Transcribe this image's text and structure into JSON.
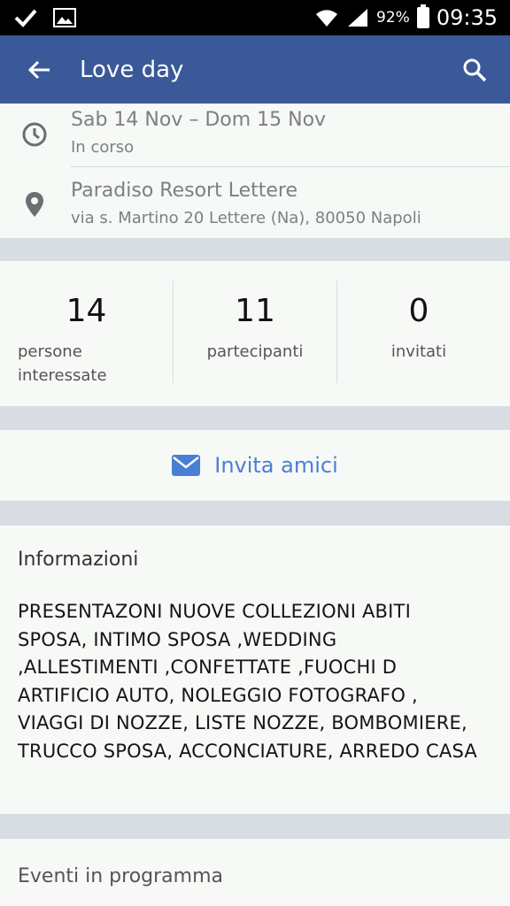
{
  "status_bar": {
    "battery": "92%",
    "time": "09:35"
  },
  "app_bar": {
    "title": "Love day"
  },
  "event": {
    "date_range": "Sab 14 Nov – Dom 15 Nov",
    "status": "In corso",
    "venue": "Paradiso Resort Lettere",
    "address": "via s. Martino 20 Lettere (Na), 80050 Napoli"
  },
  "stats": [
    {
      "value": "14",
      "label": "persone interessate"
    },
    {
      "value": "11",
      "label": "partecipanti"
    },
    {
      "value": "0",
      "label": "invitati"
    }
  ],
  "invite": {
    "label": "Invita amici"
  },
  "info": {
    "title": "Informazioni",
    "body": "PRESENTAZONI NUOVE COLLEZIONI ABITI SPOSA, INTIMO SPOSA ,WEDDING ,ALLESTIMENTI ,CONFETTATE ,FUOCHI D ARTIFICIO AUTO, NOLEGGIO FOTOGRAFO , VIAGGI DI NOZZE, LISTE NOZZE, BOMBOMIERE, TRUCCO SPOSA, ACCONCIATURE, ARREDO CASA"
  },
  "upcoming": {
    "title": "Eventi in programma"
  },
  "colors": {
    "app_bar": "#3b5998",
    "accent": "#4a7fd6",
    "card_bg": "#f6f9f5",
    "page_bg": "#d8dde3"
  }
}
